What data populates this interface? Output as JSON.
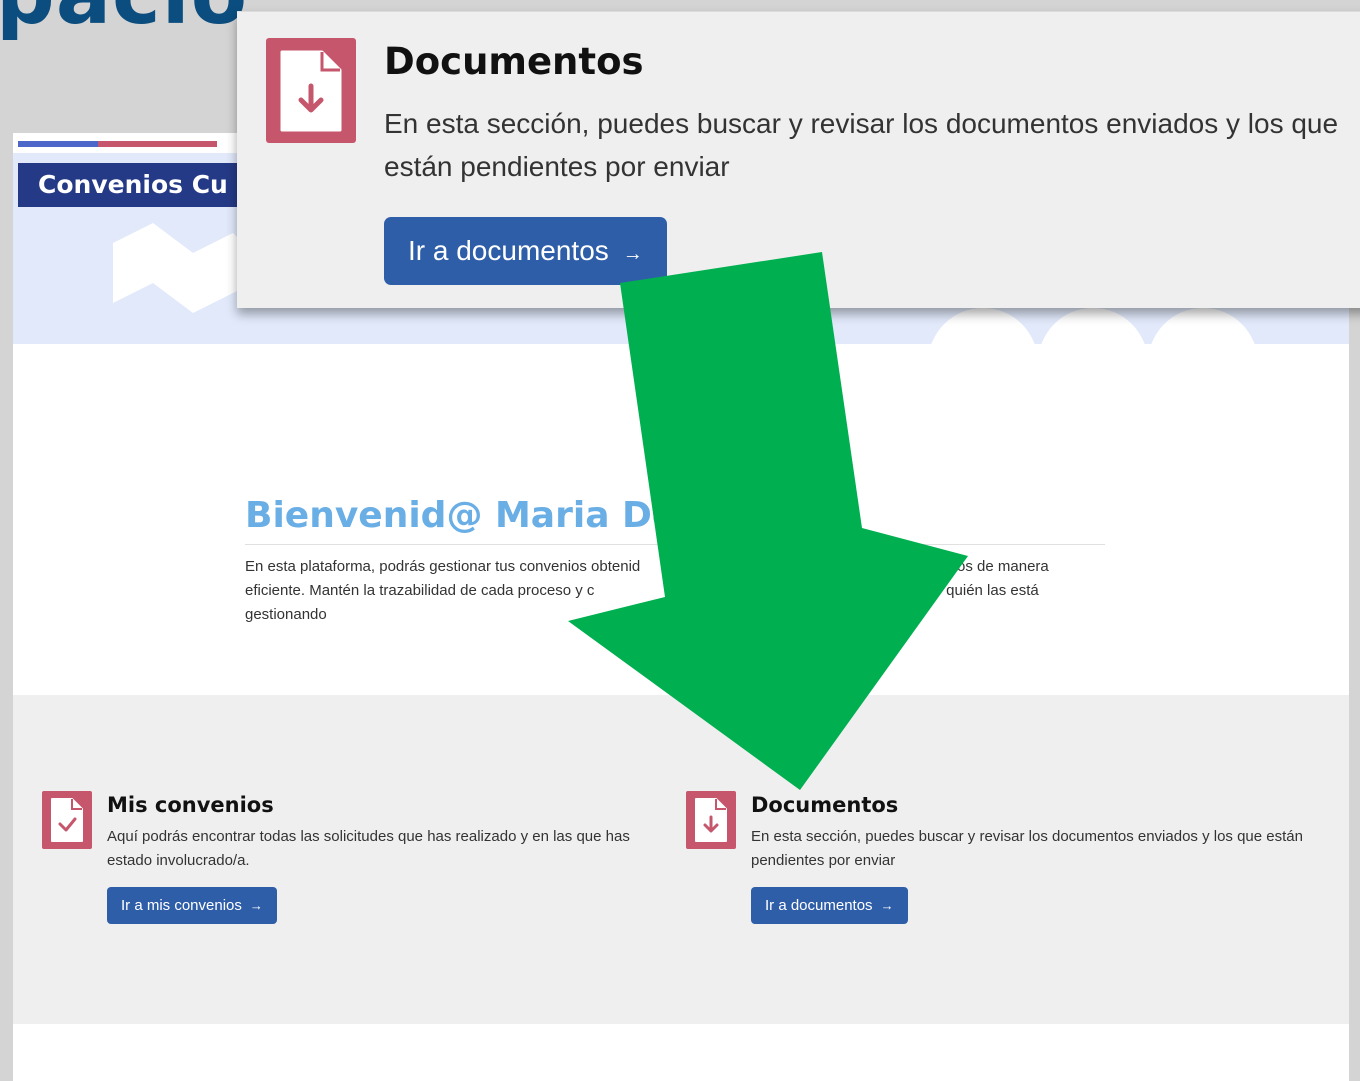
{
  "page": {
    "big_title": "pacio"
  },
  "header": {
    "brand": "Convenios Cu"
  },
  "welcome": {
    "heading": "Bienvenid@ Maria Del",
    "text": "En esta plataforma, podrás gestionar tus convenios obtenid                                   dar seguimiento a tus casos de manera eficiente. Mantén la trazabilidad de cada proceso y c                                 solicitudes, además de conocer quién las está gestionando"
  },
  "cards": {
    "convenios": {
      "title": "Mis convenios",
      "description": "Aquí podrás encontrar todas las solicitudes que has realizado y en las que has estado involucrado/a.",
      "button": "Ir a mis convenios",
      "icon": "document-check-icon"
    },
    "documentos": {
      "title": "Documentos",
      "description": "En esta sección, puedes buscar y revisar los documentos enviados y los que están pendientes por enviar",
      "button": "Ir a documentos",
      "icon": "document-download-icon"
    }
  },
  "zoom_callout": {
    "title": "Documentos",
    "description": "En esta sección, puedes buscar y revisar los documentos enviados y los que están pendientes por enviar",
    "button": "Ir a documentos",
    "icon": "document-download-icon"
  },
  "button_arrow": "→",
  "colors": {
    "accent_pink": "#c6566b",
    "button_blue": "#2f5ea9",
    "brand_navy": "#253a86",
    "heading_blue": "#6aaee6",
    "arrow_green": "#00b050"
  }
}
